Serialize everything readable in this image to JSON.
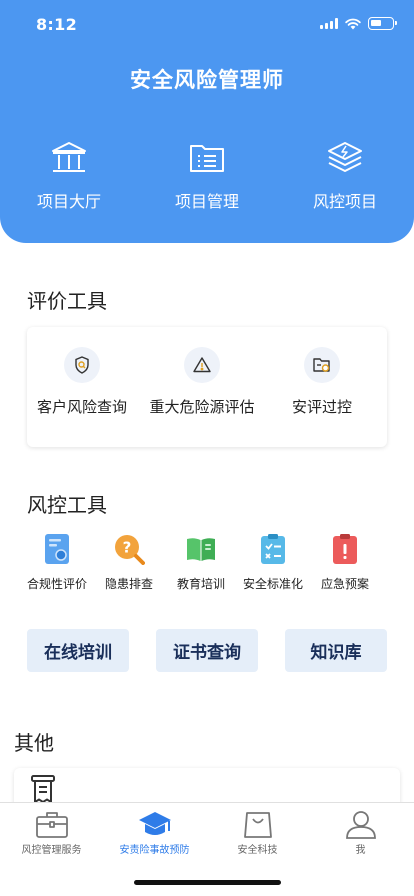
{
  "status_bar": {
    "time": "8:12"
  },
  "header": {
    "title": "安全风险管理师",
    "nav": [
      {
        "label": "项目大厅",
        "icon": "building-icon"
      },
      {
        "label": "项目管理",
        "icon": "folder-list-icon"
      },
      {
        "label": "风控项目",
        "icon": "layers-icon"
      }
    ]
  },
  "eval_tools": {
    "title": "评价工具",
    "items": [
      {
        "label": "客户风险查询",
        "icon": "shield-search-icon"
      },
      {
        "label": "重大危险源评估",
        "icon": "warning-triangle-icon"
      },
      {
        "label": "安评过控",
        "icon": "folder-clock-icon"
      }
    ]
  },
  "risk_tools": {
    "title": "风控工具",
    "items": [
      {
        "label": "合规性评价",
        "icon": "compliance-doc-icon"
      },
      {
        "label": "隐患排查",
        "icon": "question-search-icon"
      },
      {
        "label": "教育培训",
        "icon": "open-book-icon"
      },
      {
        "label": "安全标准化",
        "icon": "checklist-icon"
      },
      {
        "label": "应急预案",
        "icon": "emergency-clipboard-icon"
      }
    ]
  },
  "quick_links": [
    "在线培训",
    "证书查询",
    "知识库"
  ],
  "other": {
    "title": "其他"
  },
  "tabbar": {
    "active_index": 1,
    "items": [
      {
        "label": "风控管理服务",
        "icon": "briefcase-icon"
      },
      {
        "label": "安责险事故预防",
        "icon": "graduation-cap-icon"
      },
      {
        "label": "安全科技",
        "icon": "shopping-bag-icon"
      },
      {
        "label": "我",
        "icon": "user-icon"
      }
    ]
  },
  "colors": {
    "primary": "#4c97f1",
    "active_tab": "#2f7ce8",
    "chip_bg": "#e5eef9"
  }
}
